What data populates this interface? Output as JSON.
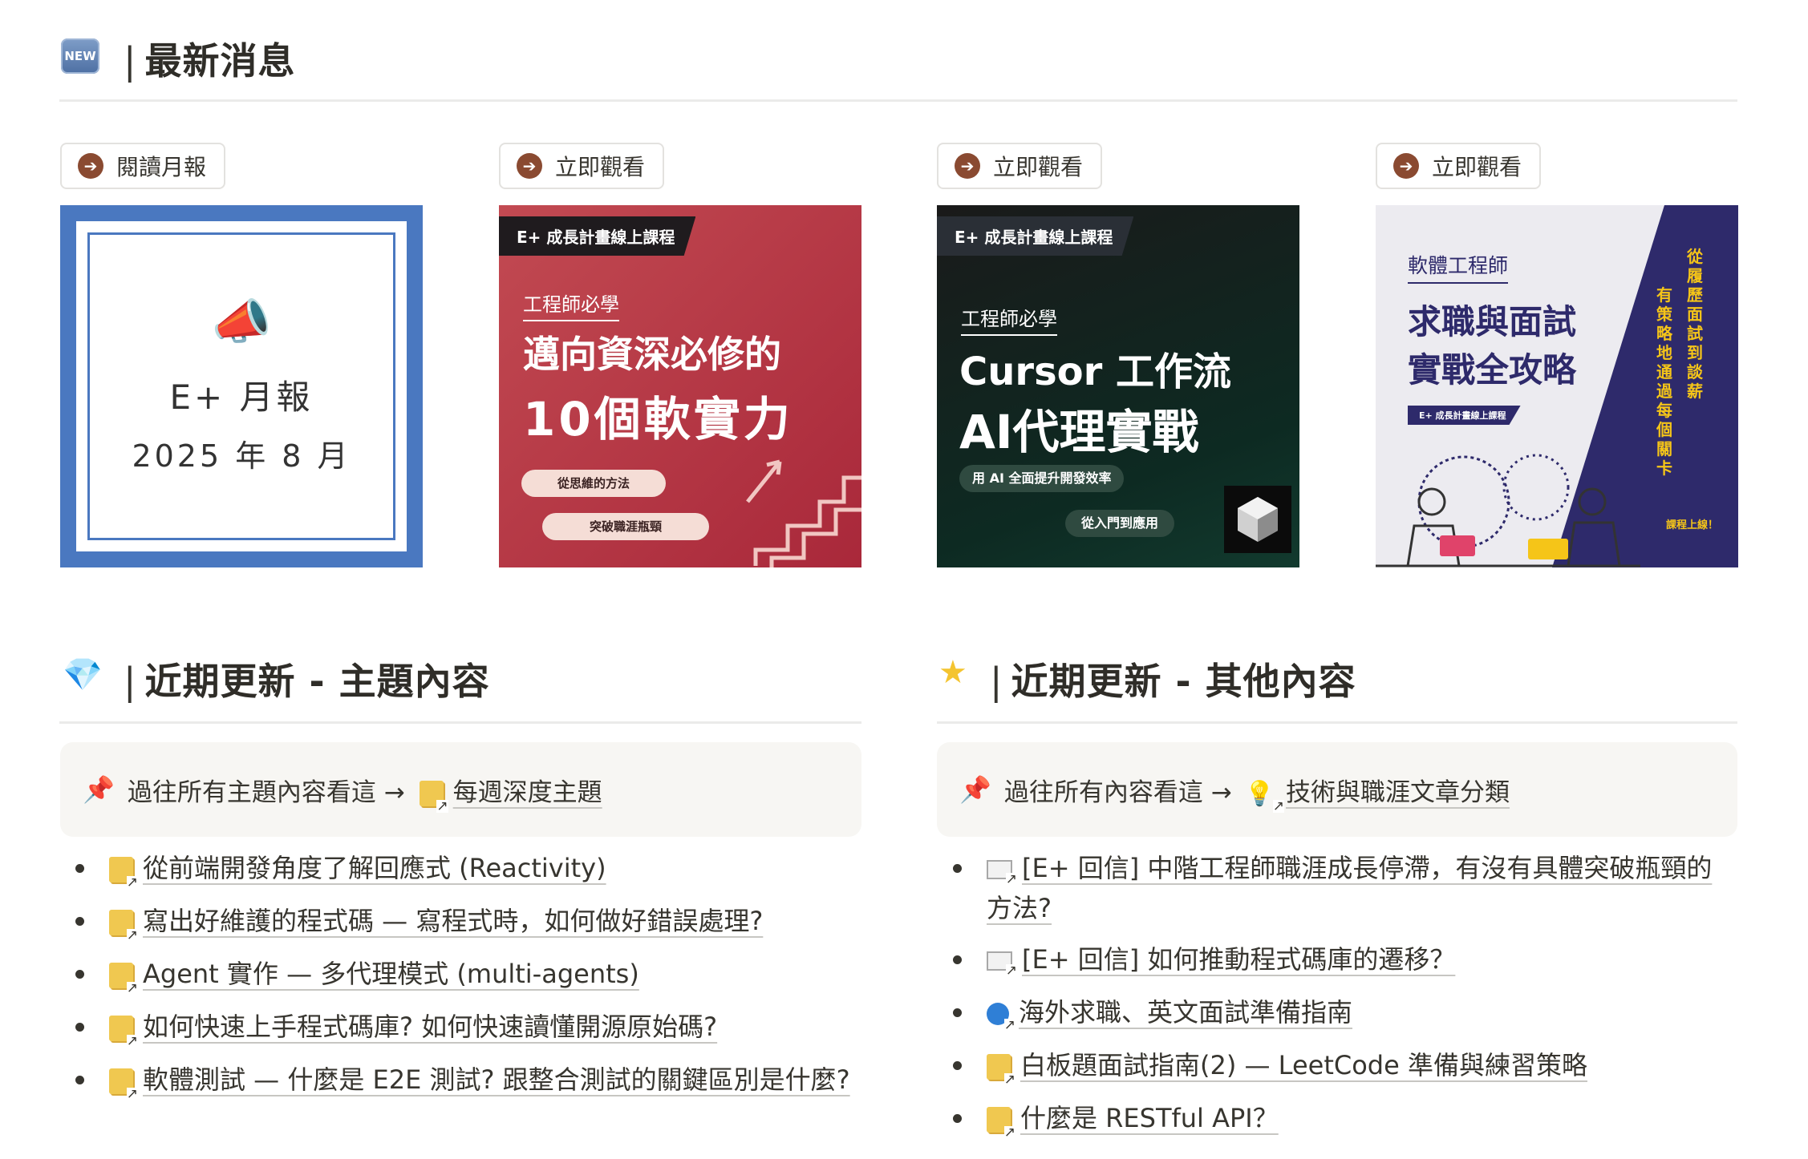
{
  "news": {
    "badge": "NEW",
    "title": "最新消息",
    "cards": [
      {
        "button": "閱讀月報",
        "line1": "E+ 月報",
        "line2": "2025 年 8 月"
      },
      {
        "button": "立即觀看",
        "tag": "E+ 成長計畫線上課程",
        "small": "工程師必學",
        "title1": "邁向資深必修的",
        "title2": "10個軟實力",
        "pill1": "從思維的方法",
        "pill2": "突破職涯瓶頸"
      },
      {
        "button": "立即觀看",
        "tag": "E+ 成長計畫線上課程",
        "small": "工程師必學",
        "title1": "Cursor 工作流",
        "title2": "AI代理實戰",
        "pill1": "用 AI 全面提升開發效率",
        "pill2": "從入門到應用"
      },
      {
        "button": "立即觀看",
        "small": "軟體工程師",
        "title1": "求職與面試",
        "title2": "實戰全攻略",
        "tag": "E+ 成長計畫線上課程",
        "vert1": "從履歷面試到談薪",
        "vert2": "有策略地通過每個關卡",
        "launch": "課程上線！"
      }
    ]
  },
  "topics": {
    "title": "近期更新 - 主題內容",
    "callout_text": "過往所有主題內容看這 →",
    "callout_link": "每週深度主題",
    "items": [
      "從前端開發角度了解回應式 (Reactivity)",
      "寫出好維護的程式碼 — 寫程式時，如何做好錯誤處理?",
      "Agent 實作 — 多代理模式 (multi-agents)",
      "如何快速上手程式碼庫? 如何快速讀懂開源原始碼?",
      "軟體測試 — 什麼是 E2E 測試? 跟整合測試的關鍵區別是什麼?"
    ]
  },
  "others": {
    "title": "近期更新 - 其他內容",
    "callout_text": "過往所有內容看這 →",
    "callout_link": "技術與職涯文章分類",
    "items": [
      "[E+ 回信] 中階工程師職涯成長停滯，有沒有具體突破瓶頸的方法?",
      "[E+ 回信] 如何推動程式碼庫的遷移？",
      "海外求職、英文面試準備指南",
      "白板題面試指南(2) — LeetCode 準備與練習策略",
      "什麼是 RESTful API？"
    ],
    "item_icons": [
      "mail-icon",
      "mail-icon",
      "globe-icon",
      "doc-icon",
      "doc-icon"
    ]
  },
  "colors": {
    "card1_frame": "#4a78c0",
    "card2_bg": "#b5323e",
    "card3_bg": "#10201c",
    "card4_navy": "#2e2a6b",
    "card4_accent": "#f5c518"
  }
}
